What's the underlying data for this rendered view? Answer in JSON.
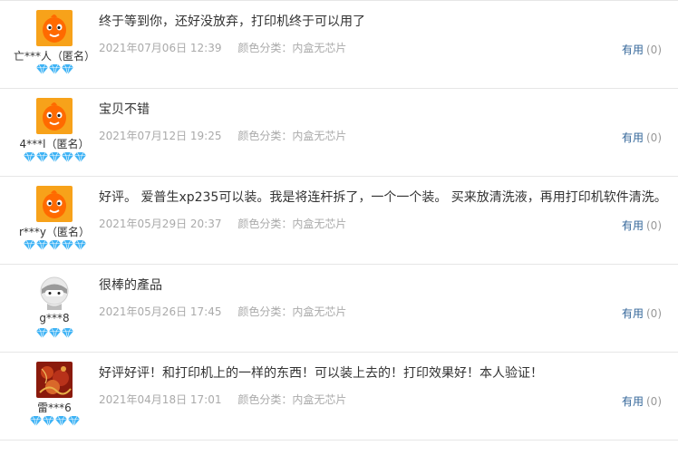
{
  "reviews": [
    {
      "user": "亡***人（匿名）",
      "avatar": "orange-cartoon-avatar",
      "gems": 3,
      "content": "终于等到你，还好没放弃，打印机终于可以用了",
      "date": "2021年07月06日 12:39",
      "sku_label": "颜色分类：",
      "sku_value": "内盒无芯片",
      "useful_label": "有用",
      "useful_count": "(0)"
    },
    {
      "user": "4***l（匿名）",
      "avatar": "orange-cartoon-avatar",
      "gems": 5,
      "content": "宝贝不错",
      "date": "2021年07月12日 19:25",
      "sku_label": "颜色分类：",
      "sku_value": "内盒无芯片",
      "useful_label": "有用",
      "useful_count": "(0)"
    },
    {
      "user": "r***y（匿名）",
      "avatar": "orange-cartoon-avatar",
      "gems": 5,
      "content": "好评。 爱普生xp235可以装。我是将连杆拆了，一个一个装。 买来放清洗液，再用打印机软件清洗。",
      "date": "2021年05月29日 20:37",
      "sku_label": "颜色分类：",
      "sku_value": "内盒无芯片",
      "useful_label": "有用",
      "useful_count": "(0)"
    },
    {
      "user": "g***8",
      "avatar": "gray-ninja-avatar",
      "gems": 3,
      "content": "很棒的產品",
      "date": "2021年05月26日 17:45",
      "sku_label": "颜色分类：",
      "sku_value": "内盒无芯片",
      "useful_label": "有用",
      "useful_count": "(0)"
    },
    {
      "user": "雷***6",
      "avatar": "red-painting-avatar",
      "gems": 4,
      "content": "好评好评！和打印机上的一样的东西！可以装上去的！打印效果好！本人验证！",
      "date": "2021年04月18日 17:01",
      "sku_label": "颜色分类：",
      "sku_value": "内盒无芯片",
      "useful_label": "有用",
      "useful_count": "(0)"
    }
  ],
  "colors": {
    "gem": "#3fb3f5",
    "useful_link": "#336699",
    "meta_text": "#aaaaaa",
    "divider": "#e6e6e6"
  }
}
